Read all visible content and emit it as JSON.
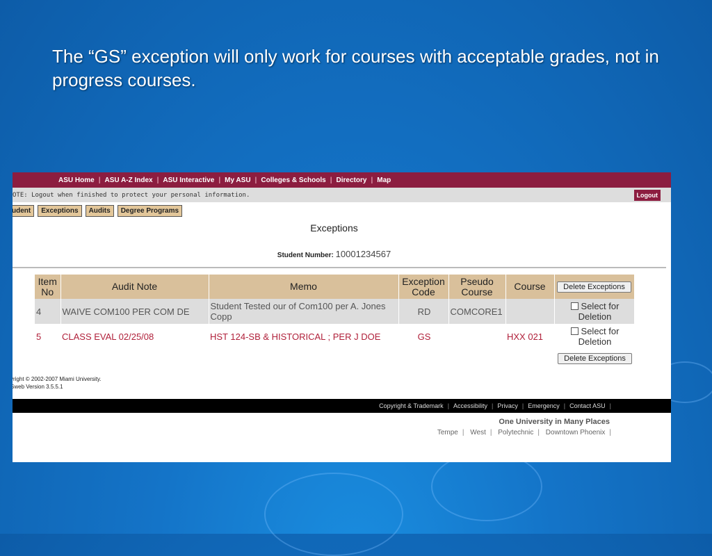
{
  "slide": {
    "title": "The “GS” exception will only work for courses with acceptable grades, not in progress courses."
  },
  "topnav": [
    "ASU Home",
    "ASU A-Z Index",
    "ASU Interactive",
    "My ASU",
    "Colleges & Schools",
    "Directory",
    "Map"
  ],
  "note": "OTE: Logout when finished to protect your personal information.",
  "logout": "Logout",
  "tabs": [
    "udent",
    "Exceptions",
    "Audits",
    "Degree Programs"
  ],
  "heading": "Exceptions",
  "student_label": "Student Number:",
  "student_number": "10001234567",
  "table": {
    "headers": [
      "Item No",
      "Audit Note",
      "Memo",
      "Exception Code",
      "Pseudo Course",
      "Course"
    ],
    "delete_label": "Delete Exceptions",
    "select_label": "Select for Deletion",
    "rows": [
      {
        "item": "4",
        "note": "WAIVE COM100 PER COM DE",
        "memo": "Student Tested our of Com100 per A. Jones Copp",
        "code": "RD",
        "pseudo": "COMCORE1",
        "course": ""
      },
      {
        "item": "5",
        "note": "CLASS EVAL 02/25/08",
        "memo": "HST 124-SB & HISTORICAL ; PER J DOE",
        "code": "GS",
        "pseudo": "",
        "course": "HXX 021"
      }
    ]
  },
  "copyright": "yright © 2002-2007 Miami University.",
  "version": "Sweb Version 3.5.5.1",
  "footer_links": [
    "Copyright & Trademark",
    "Accessibility",
    "Privacy",
    "Emergency",
    "Contact ASU"
  ],
  "tagline": "One University in Many Places",
  "campuses": [
    "Tempe",
    "West",
    "Polytechnic",
    "Downtown Phoenix"
  ]
}
